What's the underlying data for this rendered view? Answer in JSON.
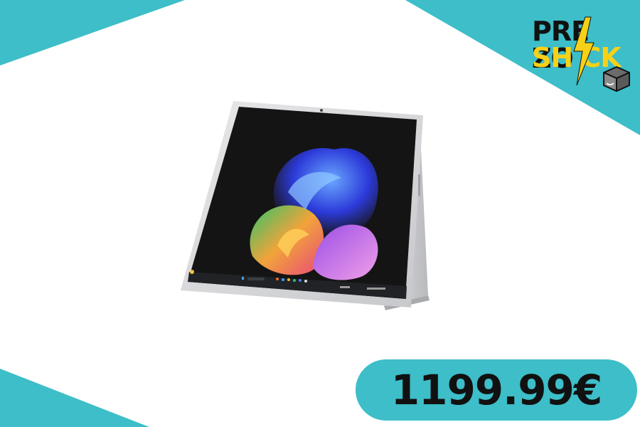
{
  "brand": {
    "line1": "PRE ZO",
    "line2": "SH CK",
    "accent_color": "#3dbec8",
    "bolt_color": "#f7d117",
    "icon": "package-box-icon"
  },
  "product": {
    "image": "tablet-with-kickstand-image"
  },
  "price": {
    "label": "1199.99€"
  }
}
